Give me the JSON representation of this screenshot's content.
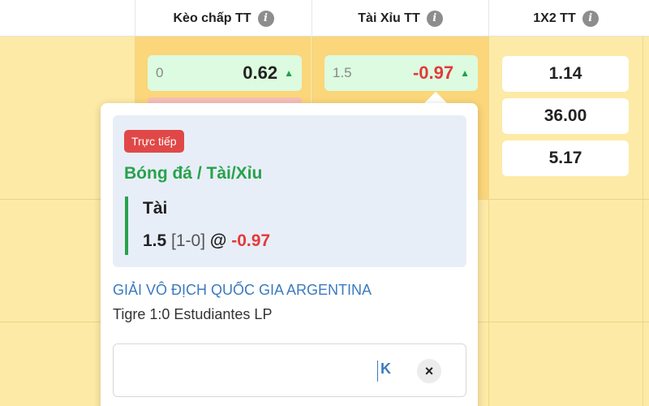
{
  "header": {
    "columns": [
      {
        "label": "Kèo chấp TT"
      },
      {
        "label": "Tài Xỉu TT"
      },
      {
        "label": "1X2 TT"
      }
    ],
    "info_icon": "i"
  },
  "odds": {
    "handicap": {
      "line": "0",
      "price": "0.62",
      "trend_icon": "▲"
    },
    "over_under": {
      "line": "1.5",
      "price": "-0.97",
      "trend_icon": "▲"
    },
    "x12": [
      "1.14",
      "36.00",
      "5.17"
    ]
  },
  "popup": {
    "live_badge": "Trực tiếp",
    "sport_market": "Bóng đá / Tài/Xỉu",
    "selection": "Tài",
    "handicap": "1.5",
    "score": "[1-0]",
    "at": "@",
    "price": "-0.97",
    "league": "GIẢI VÔ ĐỊCH QUỐC GIA ARGENTINA",
    "match": "Tigre 1:0 Estudiantes LP",
    "stake": {
      "value": "",
      "k_label": "K",
      "clear_icon": "×"
    }
  },
  "colors": {
    "background": "#fdeaa6",
    "green": "#27a24c",
    "red": "#e23a3a",
    "blue": "#3b7bbf",
    "live_badge": "#e04848"
  }
}
